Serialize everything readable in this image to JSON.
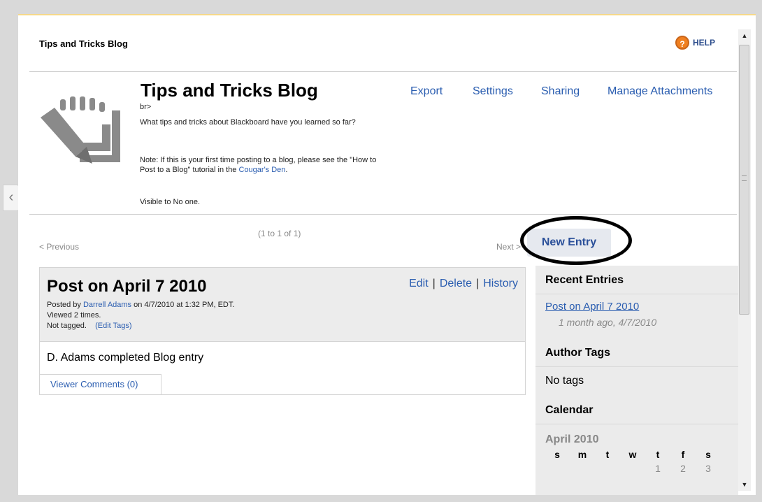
{
  "header": {
    "title": "Tips and Tricks Blog",
    "help_label": "HELP",
    "help_icon": "help-circle-icon"
  },
  "blog": {
    "title": "Tips and Tricks Blog",
    "stray_text": "br>",
    "description": "What tips and tricks about Blackboard have you learned so far?",
    "note": "Note: If this is your first time posting to a blog, please see the \"How to Post to a Blog\" tutorial in the",
    "note_link": "Cougar's Den",
    "note_end": ".",
    "visibility": "Visible to No one."
  },
  "menu": {
    "export": "Export",
    "settings": "Settings",
    "sharing": "Sharing",
    "manage_attachments": "Manage Attachments"
  },
  "pager": {
    "previous": "< Previous",
    "count": "(1 to 1 of 1)",
    "next": "Next >"
  },
  "new_entry_label": "New Entry",
  "entry": {
    "title": "Post on April 7 2010",
    "posted_by_prefix": "Posted by ",
    "author": "Darrell Adams",
    "posted_on": " on 4/7/2010 at 1:32 PM, EDT.",
    "views": "Viewed 2 times.",
    "tags_status": "Not tagged.",
    "edit_tags": "(Edit Tags)",
    "actions": {
      "edit": "Edit",
      "delete": "Delete",
      "history": "History",
      "separator": "|"
    },
    "body": "D. Adams completed Blog entry",
    "comments_tab": "Viewer Comments (0)"
  },
  "sidebar": {
    "recent_heading": "Recent Entries",
    "recent_link": "Post on April 7 2010",
    "recent_meta": "1 month ago, 4/7/2010",
    "tags_heading": "Author Tags",
    "no_tags": "No tags",
    "calendar_heading": "Calendar",
    "calendar_month": "April 2010",
    "weekdays": [
      "s",
      "m",
      "t",
      "w",
      "t",
      "f",
      "s"
    ],
    "first_row_dates": [
      "",
      "",
      "",
      "",
      "1",
      "2",
      "3"
    ]
  }
}
